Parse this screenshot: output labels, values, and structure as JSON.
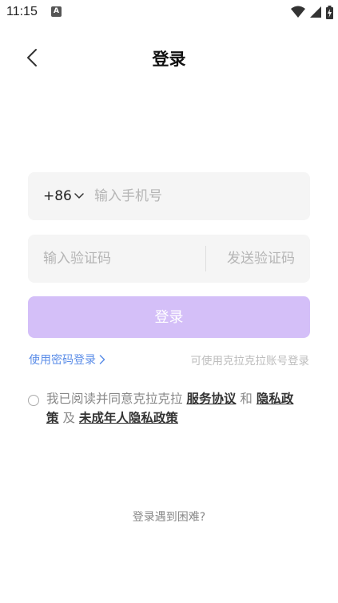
{
  "status_bar": {
    "time": "11:15",
    "notification_letter": "A",
    "icons": [
      "wifi-icon",
      "signal-icon",
      "battery-charging-icon"
    ]
  },
  "nav": {
    "title": "登录",
    "back_icon": "chevron-left-icon"
  },
  "phone": {
    "country_code": "+86",
    "placeholder": "输入手机号",
    "value": ""
  },
  "code": {
    "placeholder": "输入验证码",
    "value": "",
    "send_label": "发送验证码"
  },
  "login_button": "登录",
  "links": {
    "password_login": "使用密码登录",
    "alt_account_login": "可使用克拉克拉账号登录"
  },
  "agreement": {
    "prefix": "我已阅读并同意克拉克拉",
    "service": "服务协议",
    "and": "和",
    "privacy": "隐私政策",
    "and2": "及",
    "minor_privacy": "未成年人隐私政策"
  },
  "help": "登录遇到困难?",
  "colors": {
    "accent_disabled": "#d4bff8",
    "link": "#5b8de8",
    "field_bg": "#f5f5f5"
  }
}
